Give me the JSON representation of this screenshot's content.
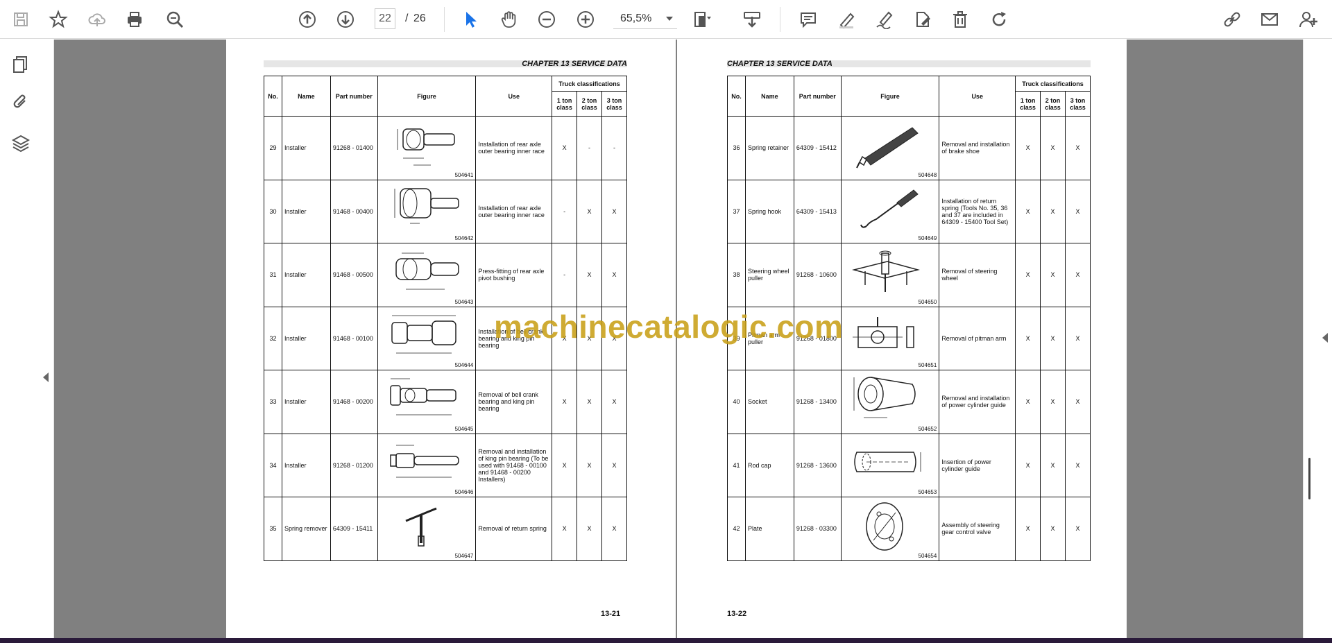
{
  "toolbar": {
    "page_current": "22",
    "page_separator": "/",
    "page_total": "26",
    "zoom": "65,5%"
  },
  "pages": {
    "left": {
      "chapter_title": "CHAPTER 13 SERVICE DATA",
      "page_number": "13-21",
      "rows": [
        {
          "no": "29",
          "name": "Installer",
          "part": "91268 - 01400",
          "code": "504641",
          "use": "Installation of rear axle outer bearing inner race",
          "c1": "X",
          "c2": "-",
          "c3": "-"
        },
        {
          "no": "30",
          "name": "Installer",
          "part": "91468 - 00400",
          "code": "504642",
          "use": "Installation of rear axle outer bearing inner race",
          "c1": "-",
          "c2": "X",
          "c3": "X"
        },
        {
          "no": "31",
          "name": "Installer",
          "part": "91468 - 00500",
          "code": "504643",
          "use": "Press-fitting of rear axle pivot bushing",
          "c1": "-",
          "c2": "X",
          "c3": "X"
        },
        {
          "no": "32",
          "name": "Installer",
          "part": "91468 - 00100",
          "code": "504644",
          "use": "Installation of bell crank bearing and king pin bearing",
          "c1": "X",
          "c2": "X",
          "c3": "X"
        },
        {
          "no": "33",
          "name": "Installer",
          "part": "91468 - 00200",
          "code": "504645",
          "use": "Removal of bell crank bearing and king pin bearing",
          "c1": "X",
          "c2": "X",
          "c3": "X"
        },
        {
          "no": "34",
          "name": "Installer",
          "part": "91268 - 01200",
          "code": "504646",
          "use": "Removal and installation of king pin bearing (To be used with 91468 - 00100 and 91468 - 00200 Installers)",
          "c1": "X",
          "c2": "X",
          "c3": "X"
        },
        {
          "no": "35",
          "name": "Spring remover",
          "part": "64309 - 15411",
          "code": "504647",
          "use": "Removal of return spring",
          "c1": "X",
          "c2": "X",
          "c3": "X"
        }
      ]
    },
    "right": {
      "chapter_title": "CHAPTER 13 SERVICE DATA",
      "page_number": "13-22",
      "rows": [
        {
          "no": "36",
          "name": "Spring retainer",
          "part": "64309 - 15412",
          "code": "504648",
          "use": "Removal and installation of brake shoe",
          "c1": "X",
          "c2": "X",
          "c3": "X"
        },
        {
          "no": "37",
          "name": "Spring hook",
          "part": "64309 - 15413",
          "code": "504649",
          "use": "Installation of return spring (Tools No. 35, 36 and 37 are included in 64309 - 15400 Tool Set)",
          "c1": "X",
          "c2": "X",
          "c3": "X"
        },
        {
          "no": "38",
          "name": "Steering wheel puller",
          "part": "91268 - 10600",
          "code": "504650",
          "use": "Removal of steering wheel",
          "c1": "X",
          "c2": "X",
          "c3": "X"
        },
        {
          "no": "39",
          "name": "Pitman arm puller",
          "part": "91268 - 01800",
          "code": "504651",
          "use": "Removal of pitman arm",
          "c1": "X",
          "c2": "X",
          "c3": "X"
        },
        {
          "no": "40",
          "name": "Socket",
          "part": "91268 - 13400",
          "code": "504652",
          "use": "Removal and installation of power cylinder guide",
          "c1": "X",
          "c2": "X",
          "c3": "X"
        },
        {
          "no": "41",
          "name": "Rod cap",
          "part": "91268 - 13600",
          "code": "504653",
          "use": "Insertion of power cylinder guide",
          "c1": "X",
          "c2": "X",
          "c3": "X"
        },
        {
          "no": "42",
          "name": "Plate",
          "part": "91268 - 03300",
          "code": "504654",
          "use": "Assembly of steering gear control valve",
          "c1": "X",
          "c2": "X",
          "c3": "X"
        }
      ]
    }
  },
  "table_headers": {
    "no": "No.",
    "name": "Name",
    "part": "Part number",
    "figure": "Figure",
    "use": "Use",
    "truck": "Truck classifications",
    "c1": "1 ton class",
    "c2": "2 ton class",
    "c3": "3 ton class"
  },
  "watermark": "machinecatalogic.com",
  "colors": {
    "accent_blue": "#1a73e8",
    "watermark": "#c9a018",
    "viewport_bg": "#808080"
  },
  "icons": {
    "toolbar": [
      "save-icon",
      "bookmark-star-icon",
      "cloud-upload-icon",
      "print-icon",
      "zoom-search-icon",
      "page-up-icon",
      "page-down-icon",
      "select-arrow-icon",
      "hand-icon",
      "zoom-out-icon",
      "zoom-in-icon",
      "fit-page-icon",
      "download-icon",
      "comment-icon",
      "highlight-icon",
      "sign-icon",
      "edit-icon",
      "delete-icon",
      "rotate-icon",
      "share-link-icon",
      "email-icon",
      "add-user-icon"
    ],
    "sidebar": [
      "pages-icon",
      "attachment-icon",
      "layers-icon"
    ]
  }
}
